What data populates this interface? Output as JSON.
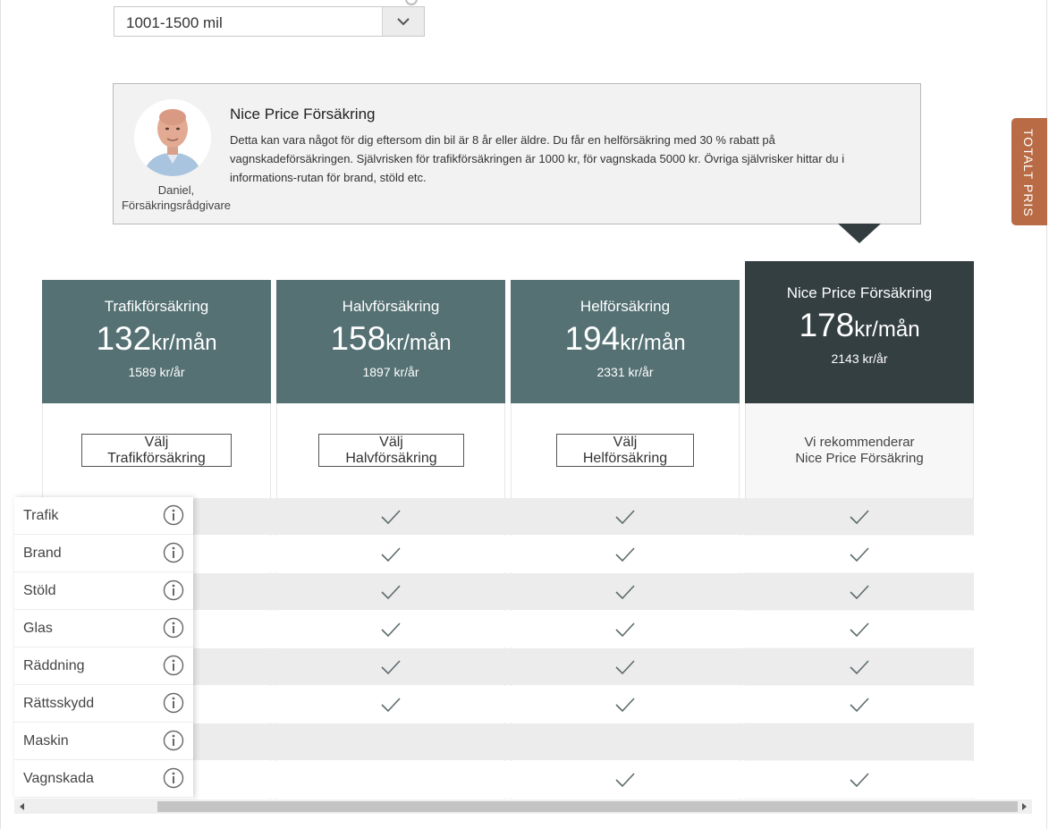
{
  "mileage_select": {
    "value": "1001-1500 mil"
  },
  "advisor": {
    "title": "Nice Price Försäkring",
    "text": "Detta kan vara något för dig eftersom din bil är 8 år eller äldre. Du får en helförsäkring med 30 % rabatt på vagnskadeförsäkringen. Självrisken för trafikförsäkringen är 1000 kr, för vagnskada 5000 kr. Övriga självrisker hittar du i informations-rutan för brand, stöld etc.",
    "name": "Daniel,",
    "role": "Försäkringsrådgivare"
  },
  "side_tab": {
    "label": "TOTALT PRIS"
  },
  "plans": [
    {
      "name": "Trafikförsäkring",
      "price": "132",
      "unit": "kr/mån",
      "yearly": "1589 kr/år",
      "button": "Välj Trafikförsäkring"
    },
    {
      "name": "Halvförsäkring",
      "price": "158",
      "unit": "kr/mån",
      "yearly": "1897 kr/år",
      "button": "Välj Halvförsäkring"
    },
    {
      "name": "Helförsäkring",
      "price": "194",
      "unit": "kr/mån",
      "yearly": "2331 kr/år",
      "button": "Välj Helförsäkring"
    },
    {
      "name": "Nice Price Försäkring",
      "price": "178",
      "unit": "kr/mån",
      "yearly": "2143 kr/år",
      "recommend_line1": "Vi rekommenderar",
      "recommend_line2": "Nice Price Försäkring"
    }
  ],
  "features": [
    "Trafik",
    "Brand",
    "Stöld",
    "Glas",
    "Räddning",
    "Rättsskydd",
    "Maskin",
    "Vagnskada"
  ],
  "coverage": {
    "Trafik": [
      true,
      true,
      true,
      true
    ],
    "Brand": [
      false,
      true,
      true,
      true
    ],
    "Stöld": [
      false,
      true,
      true,
      true
    ],
    "Glas": [
      false,
      true,
      true,
      true
    ],
    "Räddning": [
      false,
      true,
      true,
      true
    ],
    "Rättsskydd": [
      false,
      true,
      true,
      true
    ],
    "Maskin": [
      false,
      false,
      false,
      false
    ],
    "Vagnskada": [
      false,
      false,
      true,
      true
    ]
  },
  "colors": {
    "header_standard": "#557174",
    "header_recommended": "#343f42",
    "side_tab": "#b86b45",
    "check": "#5d6b6d"
  }
}
